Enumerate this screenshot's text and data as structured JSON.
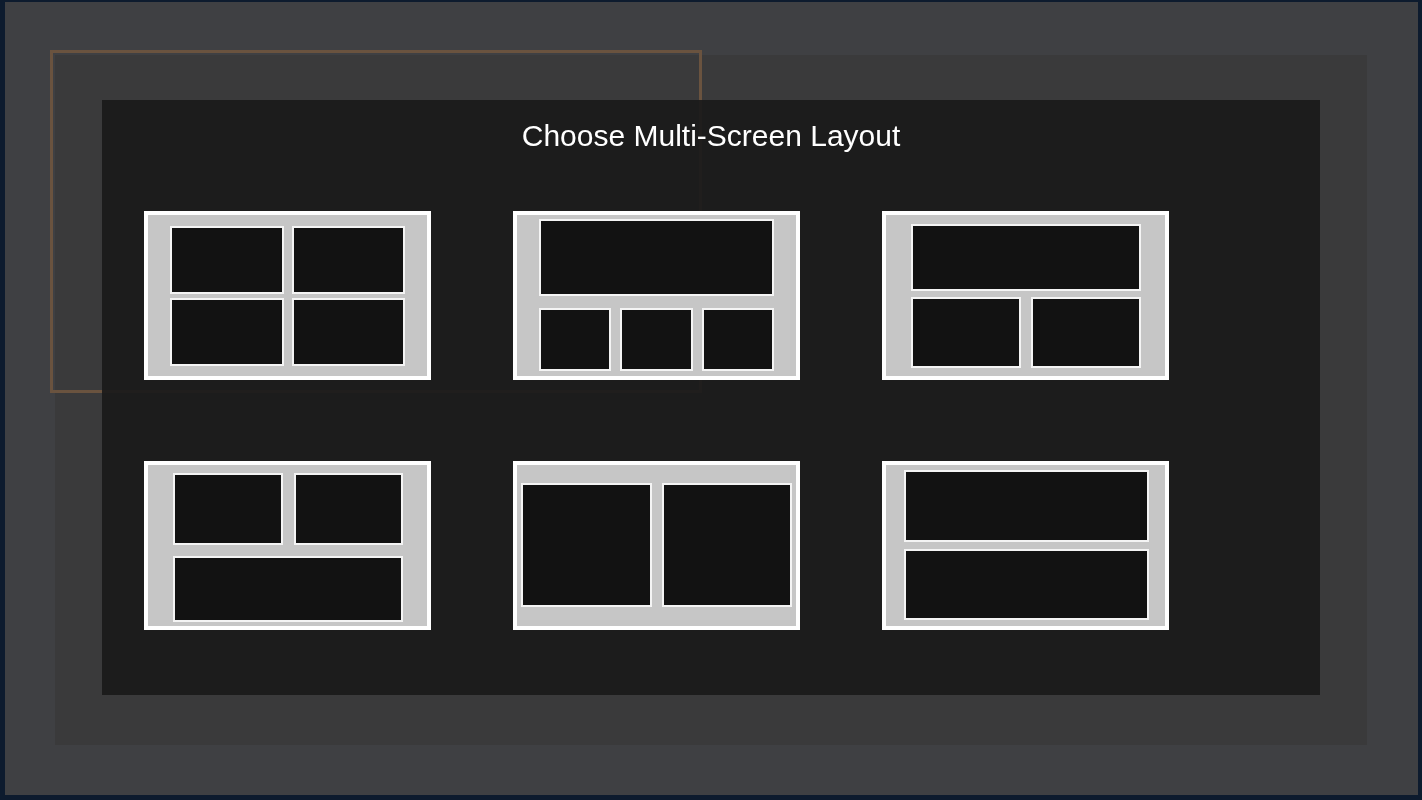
{
  "dialog": {
    "title": "Choose Multi-Screen Layout",
    "layouts": [
      {
        "kind": "quad"
      },
      {
        "kind": "top3"
      },
      {
        "kind": "top2"
      },
      {
        "kind": "bottom1"
      },
      {
        "kind": "columns"
      },
      {
        "kind": "rows"
      }
    ]
  }
}
